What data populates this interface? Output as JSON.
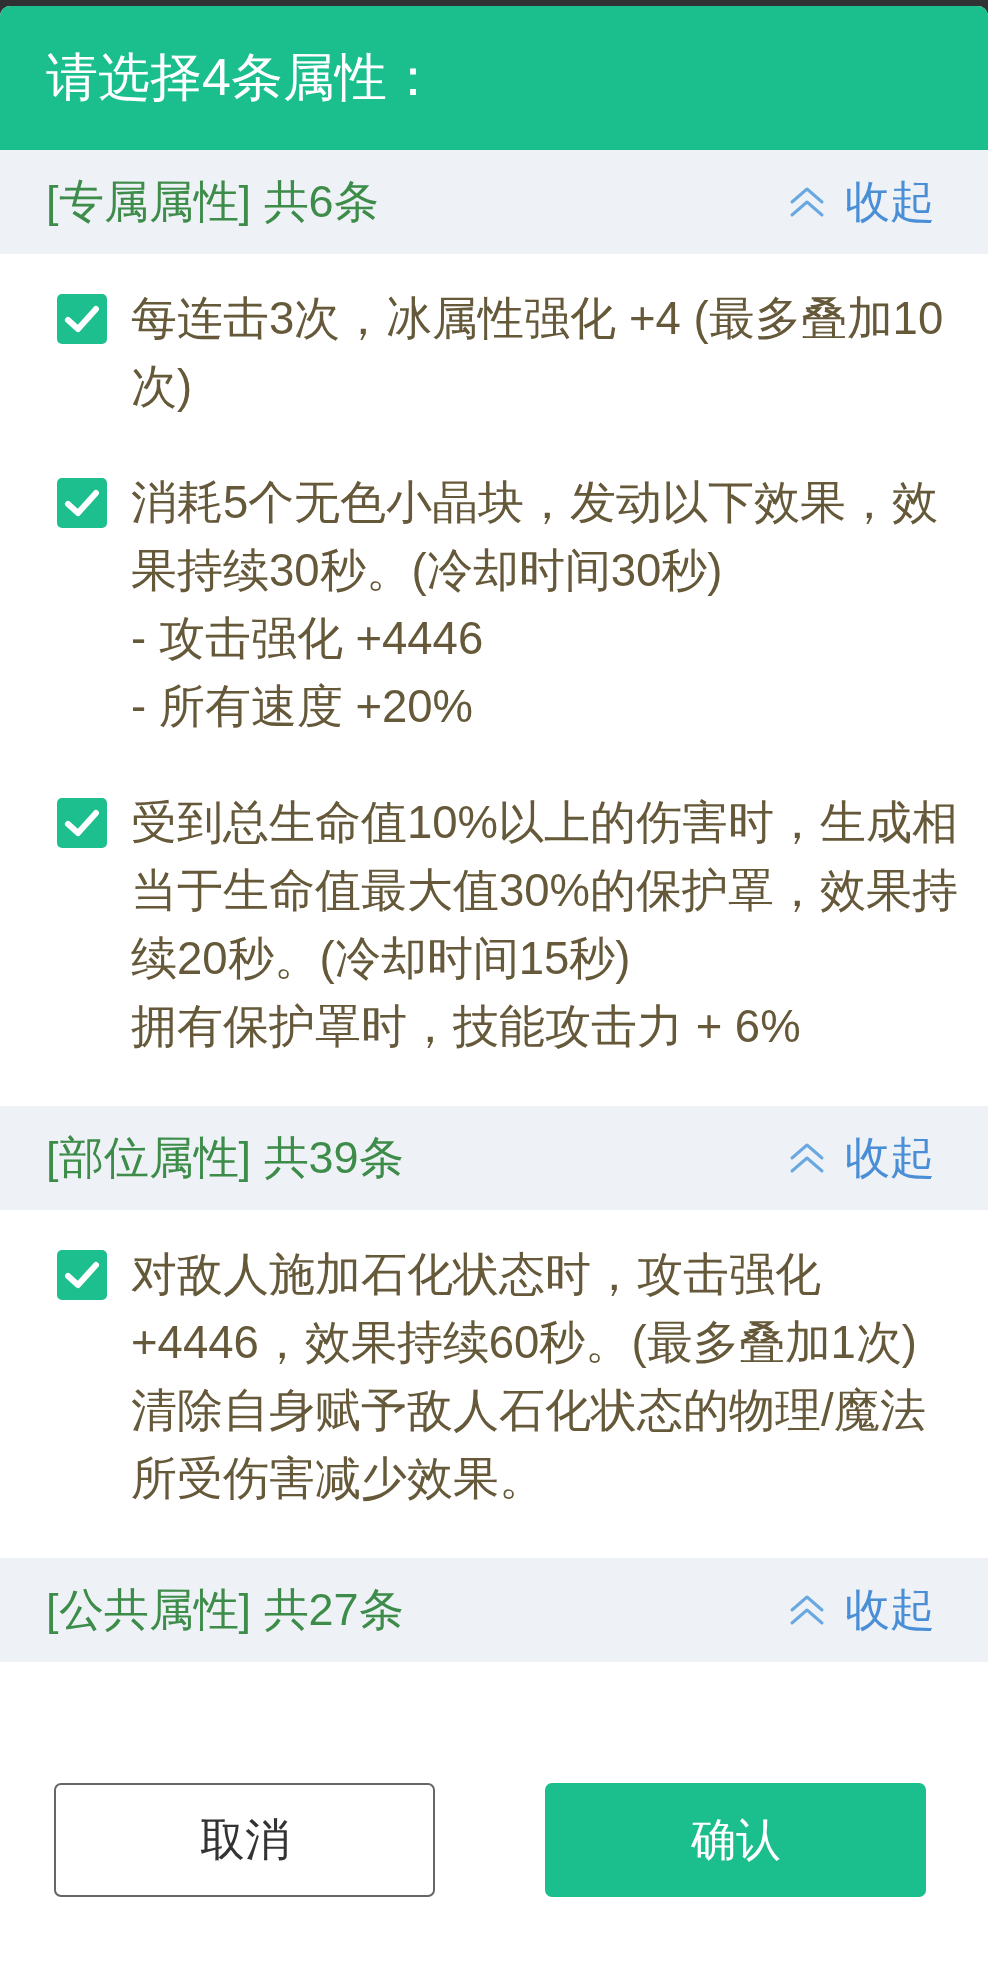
{
  "dialog": {
    "title": "请选择4条属性："
  },
  "sections": [
    {
      "label": "[专属属性] 共6条",
      "toggle": "收起",
      "expanded": true,
      "items": [
        {
          "text": "每连击3次，冰属性强化 +4 (最多叠加10次)",
          "checked": true
        },
        {
          "text": "消耗5个无色小晶块，发动以下效果，效果持续30秒。(冷却时间30秒)\n- 攻击强化 +4446\n- 所有速度 +20%",
          "checked": true
        },
        {
          "text": "受到总生命值10%以上的伤害时，生成相当于生命值最大值30%的保护罩，效果持续20秒。(冷却时间15秒)\n拥有保护罩时，技能攻击力 + 6%",
          "checked": true
        }
      ]
    },
    {
      "label": "[部位属性] 共39条",
      "toggle": "收起",
      "expanded": true,
      "items": [
        {
          "text": "对敌人施加石化状态时，攻击强化 +4446，效果持续60秒。(最多叠加1次)\n清除自身赋予敌人石化状态的物理/魔法所受伤害减少效果。",
          "checked": true
        }
      ]
    },
    {
      "label": "[公共属性] 共27条",
      "toggle": "收起",
      "expanded": true
    }
  ],
  "buttons": [
    {
      "label": "取消",
      "kind": "secondary"
    },
    {
      "label": "确认",
      "kind": "primary"
    }
  ]
}
